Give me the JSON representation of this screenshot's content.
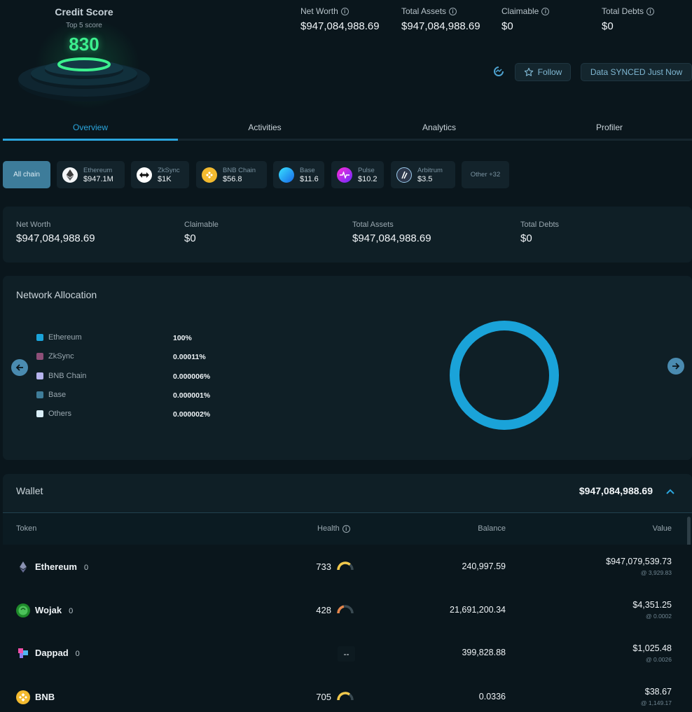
{
  "credit": {
    "title": "Credit Score",
    "subtitle": "Top 5 score",
    "score": "830"
  },
  "header_stats": [
    {
      "label": "Net Worth",
      "value": "$947,084,988.69"
    },
    {
      "label": "Total Assets",
      "value": "$947,084,988.69"
    },
    {
      "label": "Claimable",
      "value": "$0"
    },
    {
      "label": "Total Debts",
      "value": "$0"
    }
  ],
  "actions": {
    "follow": "Follow",
    "sync": "Data SYNCED Just Now"
  },
  "tabs": [
    "Overview",
    "Activities",
    "Analytics",
    "Profiler"
  ],
  "chains": {
    "all": "All chain",
    "items": [
      {
        "name": "Ethereum",
        "value": "$947.1M"
      },
      {
        "name": "ZkSync",
        "value": "$1K"
      },
      {
        "name": "BNB Chain",
        "value": "$56.8"
      },
      {
        "name": "Base",
        "value": "$11.6"
      },
      {
        "name": "Pulse",
        "value": "$10.2"
      },
      {
        "name": "Arbitrum",
        "value": "$3.5"
      }
    ],
    "other": "Other +32"
  },
  "summary": [
    {
      "label": "Net Worth",
      "value": "$947,084,988.69"
    },
    {
      "label": "Claimable",
      "value": "$0"
    },
    {
      "label": "Total Assets",
      "value": "$947,084,988.69"
    },
    {
      "label": "Total Debts",
      "value": "$0"
    }
  ],
  "allocation": {
    "title": "Network Allocation",
    "items": [
      {
        "name": "Ethereum",
        "pct": "100%",
        "color": "#1aa3d9"
      },
      {
        "name": "ZkSync",
        "pct": "0.00011%",
        "color": "#8e4f78"
      },
      {
        "name": "BNB Chain",
        "pct": "0.000006%",
        "color": "#b6b4ee"
      },
      {
        "name": "Base",
        "pct": "0.000001%",
        "color": "#3f7d99"
      },
      {
        "name": "Others",
        "pct": "0.000002%",
        "color": "#d9eef8"
      }
    ]
  },
  "wallet": {
    "title": "Wallet",
    "total": "$947,084,988.69",
    "columns": {
      "token": "Token",
      "health": "Health",
      "balance": "Balance",
      "value": "Value"
    },
    "rows": [
      {
        "name": "Ethereum",
        "count": "0",
        "health": "733",
        "health_level": 0.73,
        "health_color": "#f2c94c",
        "balance": "240,997.59",
        "value": "$947,079,539.73",
        "price": "@ 3,929.83"
      },
      {
        "name": "Wojak",
        "count": "0",
        "health": "428",
        "health_level": 0.43,
        "health_color": "#e5864c",
        "balance": "21,691,200.34",
        "value": "$4,351.25",
        "price": "@ 0.0002"
      },
      {
        "name": "Dappad",
        "count": "0",
        "health": "--",
        "health_level": null,
        "health_color": "",
        "balance": "399,828.88",
        "value": "$1,025.48",
        "price": "@ 0.0026"
      },
      {
        "name": "BNB",
        "count": "0",
        "health": "705",
        "health_level": 0.7,
        "health_color": "#f2c94c",
        "balance": "0.0336",
        "value": "$38.67",
        "price": "@ 1,149.17"
      }
    ]
  }
}
